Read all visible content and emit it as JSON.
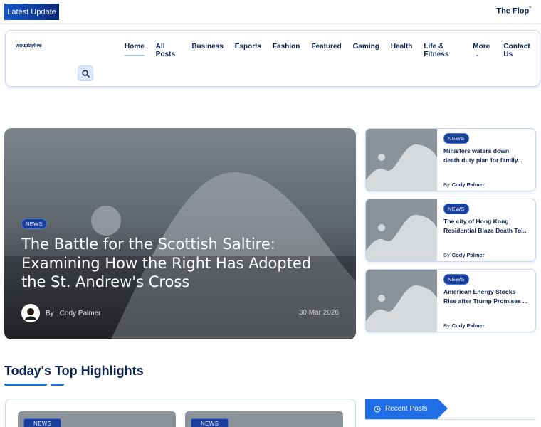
{
  "topbar": {
    "latest_label": "Latest Update",
    "ticker_text": "The Flop"
  },
  "header": {
    "logo_text": "wouplaylive",
    "nav": [
      {
        "label": "Home",
        "active": true
      },
      {
        "label": "All Posts"
      },
      {
        "label": "Business"
      },
      {
        "label": "Esports"
      },
      {
        "label": "Fashion"
      },
      {
        "label": "Featured"
      },
      {
        "label": "Gaming"
      },
      {
        "label": "Health"
      },
      {
        "label": "Life & Fitness"
      },
      {
        "label": "More"
      },
      {
        "label": "Contact Us"
      }
    ],
    "search_icon": "search-icon"
  },
  "hero": {
    "category": "NEWS",
    "title": "The Battle for the Scottish Saltire: Examining How the Right Has Adopted the St. Andrew's Cross",
    "by": "By",
    "author": "Cody Palmer",
    "date": "30 Mar 2026"
  },
  "side_posts": [
    {
      "category": "NEWS",
      "title_l1": "Ministers waters down",
      "title_l2": "death duty plan for family...",
      "by": "By",
      "author": "Cody Palmer"
    },
    {
      "category": "NEWS",
      "title_l1": "The city of Hong Kong",
      "title_l2": "Residential Blaze Death Tol...",
      "by": "By",
      "author": "Cody Palmer"
    },
    {
      "category": "NEWS",
      "title_l1": "American Energy Stocks",
      "title_l2": "Rise after Trump Promises ...",
      "by": "By",
      "author": "Cody Palmer"
    }
  ],
  "highlights": {
    "title": "Today's Top Highlights",
    "cards": [
      {
        "category": "NEWS"
      },
      {
        "category": "NEWS"
      }
    ]
  },
  "recent": {
    "label": "Recent Posts"
  },
  "colors": {
    "primary": "#1f6ee6",
    "navy": "#0b2150",
    "border": "#c9d8f0"
  }
}
